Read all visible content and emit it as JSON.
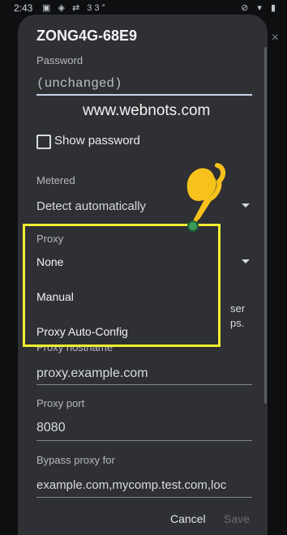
{
  "status_bar": {
    "time": "2:43",
    "temperature": "33°",
    "left_icons": "▣ ◈ ⇄",
    "right_icons": "⊘ ▾ ▮"
  },
  "background": {
    "back_icon": "←",
    "close_icon": "×"
  },
  "dialog": {
    "title": "ZONG4G-68E9",
    "password": {
      "label": "Password",
      "value": "(unchanged)"
    },
    "watermark": "www.webnots.com",
    "show_password": {
      "label": "Show password",
      "checked": false
    },
    "metered": {
      "label": "Metered",
      "value": "Detect automatically"
    },
    "proxy_menu": {
      "label": "Proxy",
      "options": [
        "None",
        "Manual",
        "Proxy Auto-Config"
      ],
      "selected": "None",
      "highlight_color": "#f0ee31"
    },
    "obscured_text": {
      "line1": "ser",
      "line2": "ps."
    },
    "proxy_hostname": {
      "label": "Proxy hostname",
      "value": "proxy.example.com"
    },
    "proxy_port": {
      "label": "Proxy port",
      "value": "8080"
    },
    "bypass_proxy": {
      "label": "Bypass proxy for",
      "value": "example.com,mycomp.test.com,loc"
    },
    "actions": {
      "cancel": "Cancel",
      "save": "Save"
    }
  },
  "colors": {
    "dialog_bg": "#2f3033",
    "screen_bg": "#0e0f11",
    "accent_yellow": "#f0ee31",
    "pointer_orange": "#f7c21b"
  }
}
